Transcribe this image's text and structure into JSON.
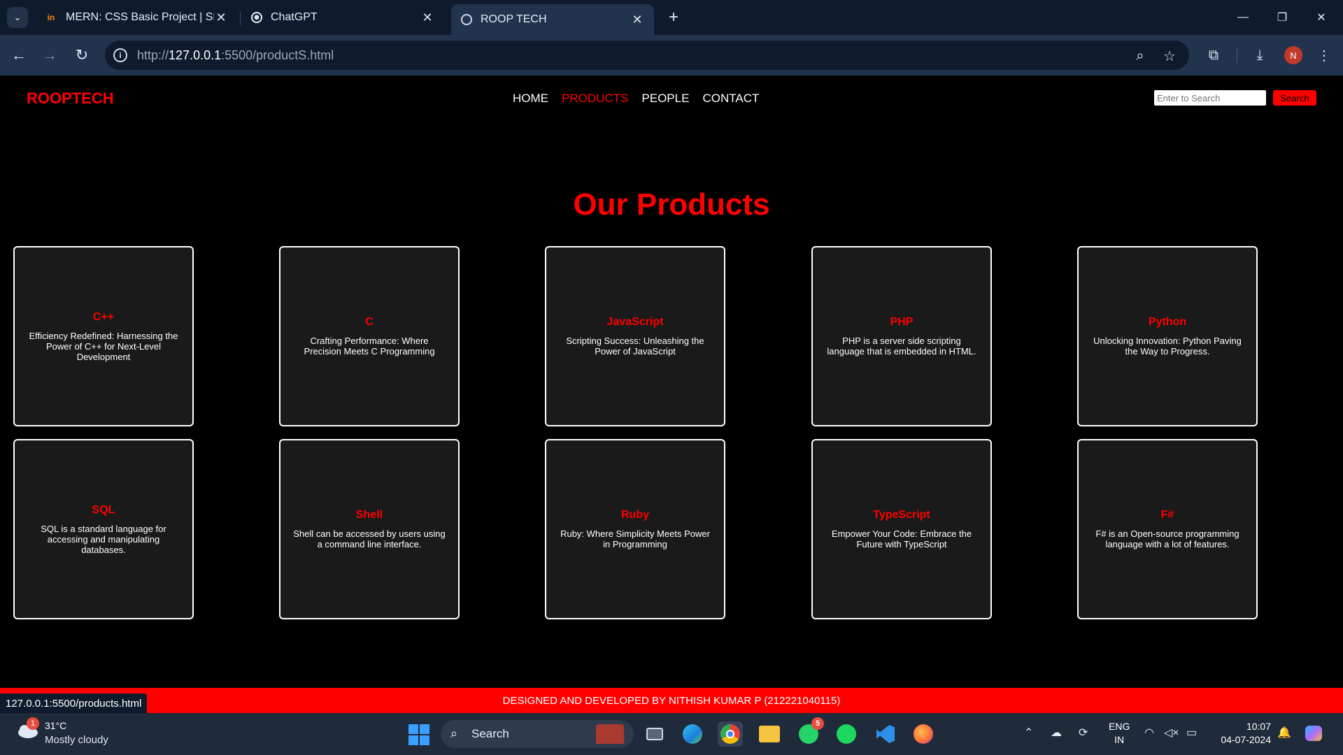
{
  "browser": {
    "tabs": [
      {
        "favicon": "in",
        "title": "MERN: CSS Basic Project | SEC",
        "active": false
      },
      {
        "favicon": "chatgpt-logo",
        "title": "ChatGPT",
        "active": false
      },
      {
        "favicon": "globe",
        "title": "ROOP TECH",
        "active": true
      }
    ],
    "url_prefix": "http://",
    "url_host": "127.0.0.1",
    "url_rest": ":5500/productS.html",
    "profile_initial": "N",
    "status_url": "127.0.0.1:5500/products.html"
  },
  "site": {
    "brand": "ROOPTECH",
    "nav": [
      {
        "label": "HOME",
        "active": false
      },
      {
        "label": "PRODUCTS",
        "active": true
      },
      {
        "label": "PEOPLE",
        "active": false
      },
      {
        "label": "CONTACT",
        "active": false
      }
    ],
    "search_placeholder": "Enter to Search",
    "search_button": "Search",
    "heading": "Our Products",
    "products": [
      {
        "title": "C++",
        "desc": "Efficiency Redefined: Harnessing the Power of C++ for Next-Level Development"
      },
      {
        "title": "C",
        "desc": "Crafting Performance: Where Precision Meets C Programming"
      },
      {
        "title": "JavaScript",
        "desc": "Scripting Success: Unleashing the Power of JavaScript"
      },
      {
        "title": "PHP",
        "desc": "PHP is a server side scripting language that is embedded in HTML."
      },
      {
        "title": "Python",
        "desc": "Unlocking Innovation: Python Paving the Way to Progress."
      },
      {
        "title": "SQL",
        "desc": "SQL is a standard language for accessing and manipulating databases."
      },
      {
        "title": "Shell",
        "desc": "Shell can be accessed by users using a command line interface."
      },
      {
        "title": "Ruby",
        "desc": "Ruby: Where Simplicity Meets Power in Programming"
      },
      {
        "title": "TypeScript",
        "desc": "Empower Your Code: Embrace the Future with TypeScript"
      },
      {
        "title": "F#",
        "desc": "F# is an Open-source programming language with a lot of features."
      }
    ],
    "footer": "DESIGNED AND DEVELOPED BY NITHISH KUMAR P (212221040115)"
  },
  "taskbar": {
    "weather_badge": "1",
    "weather_temp": "31°C",
    "weather_desc": "Mostly cloudy",
    "search_label": "Search",
    "whatsapp_badge": "5",
    "lang_line1": "ENG",
    "lang_line2": "IN",
    "time": "10:07",
    "date": "04-07-2024"
  },
  "colors": {
    "accent": "#ff0000",
    "card_bg": "#1a1a1a",
    "page_bg": "#000000"
  }
}
